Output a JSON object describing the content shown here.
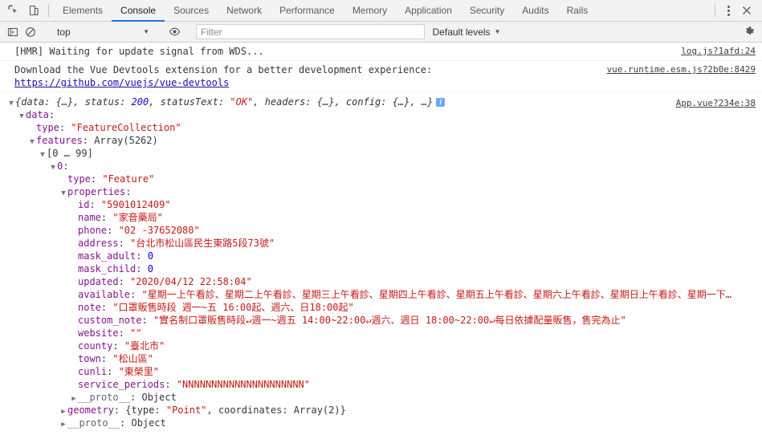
{
  "tabbar": {
    "icons": [
      {
        "name": "inspect-element-icon"
      },
      {
        "name": "toggle-device-toolbar-icon"
      }
    ],
    "tabs": [
      {
        "label": "Elements",
        "active": false
      },
      {
        "label": "Console",
        "active": true
      },
      {
        "label": "Sources",
        "active": false
      },
      {
        "label": "Network",
        "active": false
      },
      {
        "label": "Performance",
        "active": false
      },
      {
        "label": "Memory",
        "active": false
      },
      {
        "label": "Application",
        "active": false
      },
      {
        "label": "Security",
        "active": false
      },
      {
        "label": "Audits",
        "active": false
      },
      {
        "label": "Rails",
        "active": false
      }
    ],
    "more_options": "more-options-icon",
    "close": "close-icon"
  },
  "filterbar": {
    "sidebar_toggle": "show-console-sidebar-icon",
    "clear": "clear-console-icon",
    "context": "top",
    "eye": "live-expression-icon",
    "filter_placeholder": "Filter",
    "filter_value": "",
    "levels": "Default levels",
    "settings": "settings-gear-icon"
  },
  "messages": [
    {
      "text": "[HMR] Waiting for update signal from WDS...",
      "source": "log.js?1afd:24"
    },
    {
      "text": "Download the Vue Devtools extension for a better development experience:",
      "url": "https://github.com/vuejs/vue-devtools",
      "source": "vue.runtime.esm.js?2b0e:8429"
    }
  ],
  "object_message": {
    "source": "App.vue?234e:38",
    "summary": {
      "prefix": "{",
      "parts": [
        {
          "key": "data",
          "value": "{…}"
        },
        {
          "key": "status",
          "value": "200",
          "type": "num"
        },
        {
          "key": "statusText",
          "value": "\"OK\"",
          "type": "str"
        },
        {
          "key": "headers",
          "value": "{…}"
        },
        {
          "key": "config",
          "value": "{…}"
        }
      ],
      "ellipsis": "…",
      "suffix": "}",
      "info_badge": "i"
    },
    "tree": [
      {
        "indent": 1,
        "tri": "open",
        "key": "data",
        "key_style": "prop",
        "sep": ":",
        "value": ""
      },
      {
        "indent": 2,
        "tri": "none",
        "key": "type",
        "key_style": "prop",
        "sep": ": ",
        "value": "\"FeatureCollection\"",
        "vtype": "str"
      },
      {
        "indent": 2,
        "tri": "open",
        "key": "features",
        "key_style": "prop",
        "sep": ": ",
        "value": "Array(5262)",
        "vtype": "plain"
      },
      {
        "indent": 3,
        "tri": "open",
        "key": "[0 … 99]",
        "key_style": "plain",
        "sep": "",
        "value": ""
      },
      {
        "indent": 4,
        "tri": "open",
        "key": "0",
        "key_style": "prop",
        "sep": ":",
        "value": ""
      },
      {
        "indent": 5,
        "tri": "none",
        "key": "type",
        "key_style": "prop",
        "sep": ": ",
        "value": "\"Feature\"",
        "vtype": "str"
      },
      {
        "indent": 5,
        "tri": "open",
        "key": "properties",
        "key_style": "prop",
        "sep": ":",
        "value": ""
      },
      {
        "indent": 6,
        "tri": "none",
        "key": "id",
        "key_style": "prop",
        "sep": ": ",
        "value": "\"5901012409\"",
        "vtype": "str"
      },
      {
        "indent": 6,
        "tri": "none",
        "key": "name",
        "key_style": "prop",
        "sep": ": ",
        "value": "\"家音藥局\"",
        "vtype": "str"
      },
      {
        "indent": 6,
        "tri": "none",
        "key": "phone",
        "key_style": "prop",
        "sep": ": ",
        "value": "\"02 -37652080\"",
        "vtype": "str"
      },
      {
        "indent": 6,
        "tri": "none",
        "key": "address",
        "key_style": "prop",
        "sep": ": ",
        "value": "\"台北市松山區民生東路5段73號\"",
        "vtype": "str"
      },
      {
        "indent": 6,
        "tri": "none",
        "key": "mask_adult",
        "key_style": "prop",
        "sep": ": ",
        "value": "0",
        "vtype": "num"
      },
      {
        "indent": 6,
        "tri": "none",
        "key": "mask_child",
        "key_style": "prop",
        "sep": ": ",
        "value": "0",
        "vtype": "num"
      },
      {
        "indent": 6,
        "tri": "none",
        "key": "updated",
        "key_style": "prop",
        "sep": ": ",
        "value": "\"2020/04/12 22:58:04\"",
        "vtype": "str"
      },
      {
        "indent": 6,
        "tri": "none",
        "key": "available",
        "key_style": "prop",
        "sep": ": ",
        "value": "\"星期一上午看診、星期二上午看診、星期三上午看診、星期四上午看診、星期五上午看診、星期六上午看診、星期日上午看診、星期一下…",
        "vtype": "str"
      },
      {
        "indent": 6,
        "tri": "none",
        "key": "note",
        "key_style": "prop",
        "sep": ": ",
        "value": "\"口罩販售時段 週一~五 16:00起、週六、日18:00起\"",
        "vtype": "str"
      },
      {
        "indent": 6,
        "tri": "none",
        "key": "custom_note",
        "key_style": "prop",
        "sep": ": ",
        "value": "\"實名制口罩販售時段↵週一~週五 14:00~22:00↵週六、週日 18:00~22:00↵每日依據配量販售，售完為止\"",
        "vtype": "str"
      },
      {
        "indent": 6,
        "tri": "none",
        "key": "website",
        "key_style": "prop",
        "sep": ": ",
        "value": "\"\"",
        "vtype": "str"
      },
      {
        "indent": 6,
        "tri": "none",
        "key": "county",
        "key_style": "prop",
        "sep": ": ",
        "value": "\"臺北市\"",
        "vtype": "str"
      },
      {
        "indent": 6,
        "tri": "none",
        "key": "town",
        "key_style": "prop",
        "sep": ": ",
        "value": "\"松山區\"",
        "vtype": "str"
      },
      {
        "indent": 6,
        "tri": "none",
        "key": "cunli",
        "key_style": "prop",
        "sep": ": ",
        "value": "\"東榮里\"",
        "vtype": "str"
      },
      {
        "indent": 6,
        "tri": "none",
        "key": "service_periods",
        "key_style": "prop",
        "sep": ": ",
        "value": "\"NNNNNNNNNNNNNNNNNNNNN\"",
        "vtype": "str"
      },
      {
        "indent": 6,
        "tri": "closed",
        "key": "__proto__",
        "key_style": "proto",
        "sep": ": ",
        "value": "Object",
        "vtype": "plain"
      },
      {
        "indent": 5,
        "tri": "closed",
        "key": "geometry",
        "key_style": "prop",
        "sep": ": ",
        "value": "{type: \"Point\", coordinates: Array(2)}",
        "vtype": "obj-inline"
      },
      {
        "indent": 5,
        "tri": "closed",
        "key": "__proto__",
        "key_style": "proto",
        "sep": ": ",
        "value": "Object",
        "vtype": "plain"
      }
    ]
  }
}
